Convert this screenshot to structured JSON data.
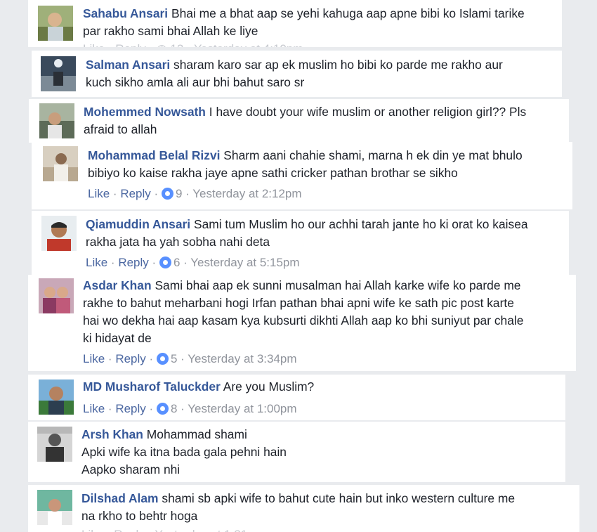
{
  "actions": {
    "like": "Like",
    "reply": "Reply"
  },
  "comments": [
    {
      "name": "Sahabu Ansari",
      "lines": [
        "Bhai me a bhat aap se yehi kahuga aap apne bibi ko Islami tarike",
        "par rakho sami bhai Allah ke liye"
      ]
    },
    {
      "name": "Salman Ansari",
      "lines": [
        "sharam karo sar ap ek muslim ho bibi ko parde me rakho aur",
        "kuch sikho amla ali aur bhi bahut saro sr"
      ]
    },
    {
      "name": "Mohemmed Nowsath",
      "lines": [
        "I have doubt your wife muslim or another religion girl?? Pls",
        "afraid to allah"
      ]
    },
    {
      "name": "Mohammad Belal Rizvi",
      "lines": [
        "Sharm aani chahie shami, marna h ek din ye mat bhulo",
        "bibiyo ko kaise rakha jaye apne sathi cricker pathan brothar se sikho"
      ],
      "reactions": "9",
      "time": "Yesterday at 2:12pm"
    },
    {
      "name": "Qiamuddin Ansari",
      "lines": [
        "Sami tum Muslim ho our achhi tarah jante ho ki orat ko kaisea",
        "rakha jata ha yah sobha nahi deta"
      ],
      "reactions": "6",
      "time": "Yesterday at 5:15pm"
    },
    {
      "name": "Asdar Khan",
      "lines": [
        "Sami bhai aap ek sunni musalman hai Allah karke wife ko parde me",
        "rakhe to bahut meharbani hogi Irfan pathan bhai apni wife ke sath pic post karte",
        "hai wo dekha hai aap kasam kya kubsurti dikhti Allah aap ko bhi suniyut par chale",
        "ki hidayat de"
      ],
      "reactions": "5",
      "time": "Yesterday at 3:34pm"
    },
    {
      "name": "MD Musharof Taluckder",
      "lines": [
        "Are you Muslim?"
      ],
      "reactions": "8",
      "time": "Yesterday at 1:00pm"
    },
    {
      "name": "Arsh Khan",
      "lines": [
        "Mohammad shami",
        "Apki wife ka itna bada gala pehni hain",
        "Aapko sharam nhi"
      ]
    },
    {
      "name": "Dilshad Alam",
      "lines": [
        "shami sb apki wife to bahut cute hain but inko western culture me",
        "na rkho to behtr hoga"
      ]
    }
  ]
}
